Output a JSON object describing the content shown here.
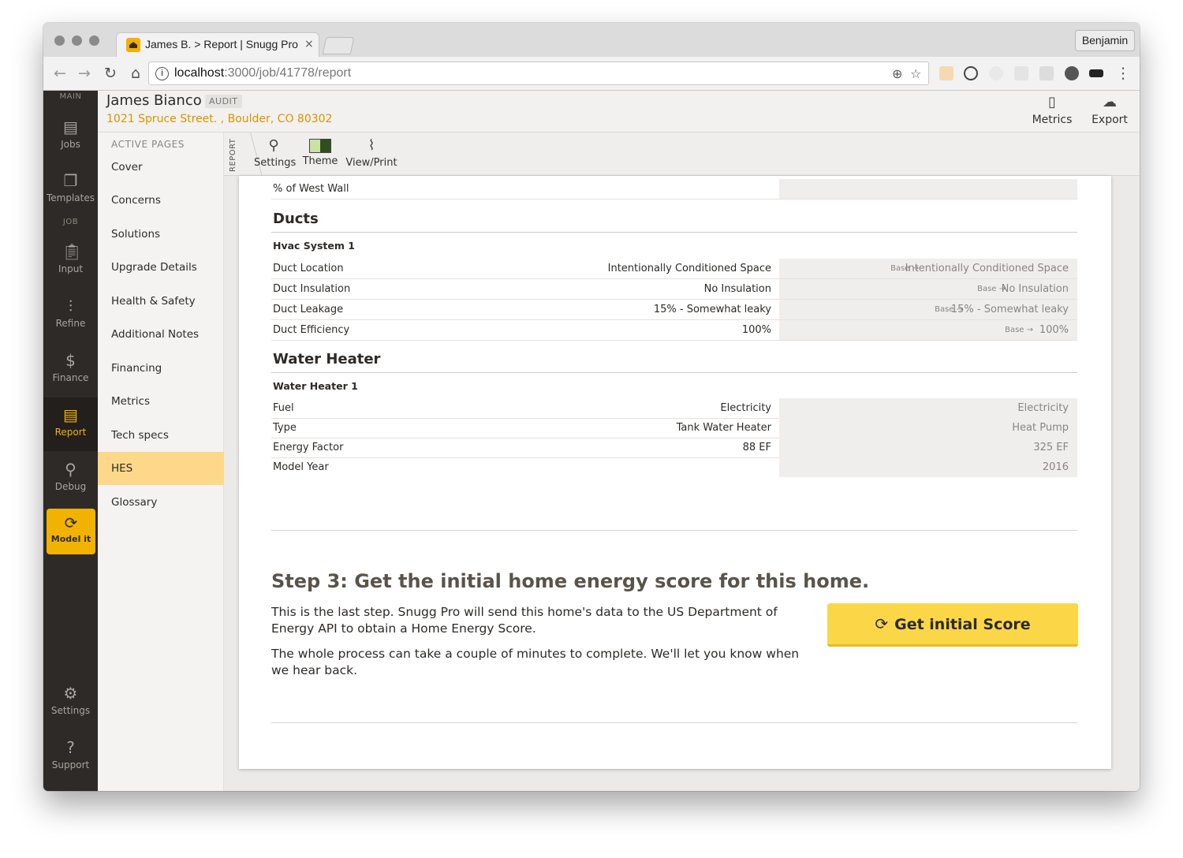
{
  "browser": {
    "tab_title": "James B. > Report | Snugg Pro",
    "tab_close": "×",
    "profile": "Benjamin",
    "url_host": "localhost",
    "url_path": ":3000/job/41778/report"
  },
  "sidebar": {
    "section_main": "MAIN",
    "section_job": "JOB",
    "items": [
      {
        "label": "Jobs",
        "icon": "jobs-icon"
      },
      {
        "label": "Templates",
        "icon": "templates-icon"
      },
      {
        "label": "Input",
        "icon": "clipboard-icon"
      },
      {
        "label": "Refine",
        "icon": "sliders-icon"
      },
      {
        "label": "Finance",
        "icon": "dollar-icon"
      },
      {
        "label": "Report",
        "icon": "report-icon"
      },
      {
        "label": "Debug",
        "icon": "wrench-icon"
      }
    ],
    "model_it": "Model it",
    "settings": "Settings",
    "support": "Support",
    "accent": "#f2b300"
  },
  "header": {
    "name": "James Bianco",
    "badge": "AUDIT",
    "address": "1021 Spruce Street. , Boulder, CO 80302",
    "metrics": "Metrics",
    "export": "Export"
  },
  "pages": {
    "title": "ACTIVE PAGES",
    "items": [
      "Cover",
      "Concerns",
      "Solutions",
      "Upgrade Details",
      "Health & Safety",
      "Additional Notes",
      "Financing",
      "Metrics",
      "Tech specs",
      "HES",
      "Glossary"
    ],
    "active": "HES"
  },
  "report_toolbar": {
    "label": "REPORT",
    "settings": "Settings",
    "theme": "Theme",
    "view_print": "View/Print"
  },
  "report": {
    "west_wall_label": "% of West Wall",
    "ducts": {
      "title": "Ducts",
      "system": "Hvac System 1",
      "rows": [
        {
          "label": "Duct Location",
          "value": "Intentionally Conditioned Space",
          "base": "Base →",
          "improved": "Intentionally Conditioned Space"
        },
        {
          "label": "Duct Insulation",
          "value": "No Insulation",
          "base": "Base →",
          "improved": "No Insulation"
        },
        {
          "label": "Duct Leakage",
          "value": "15% - Somewhat leaky",
          "base": "Base →",
          "improved": "15% - Somewhat leaky"
        },
        {
          "label": "Duct Efficiency",
          "value": "100%",
          "base": "Base →",
          "improved": "100%"
        }
      ]
    },
    "water_heater": {
      "title": "Water Heater",
      "system": "Water Heater 1",
      "rows": [
        {
          "label": "Fuel",
          "value": "Electricity",
          "improved": "Electricity"
        },
        {
          "label": "Type",
          "value": "Tank Water Heater",
          "improved": "Heat Pump"
        },
        {
          "label": "Energy Factor",
          "value": "88 EF",
          "improved": "325 EF"
        },
        {
          "label": "Model Year",
          "value": "",
          "improved": "2016"
        }
      ]
    },
    "step3": {
      "title": "Step 3: Get the initial home energy score for this home.",
      "para1": "This is the last step. Snugg Pro will send this home's data to the US Department of Energy API to obtain a Home Energy Score.",
      "para2": "The whole process can take a couple of minutes to complete. We'll let you know when we hear back.",
      "button": "Get initial Score"
    }
  }
}
